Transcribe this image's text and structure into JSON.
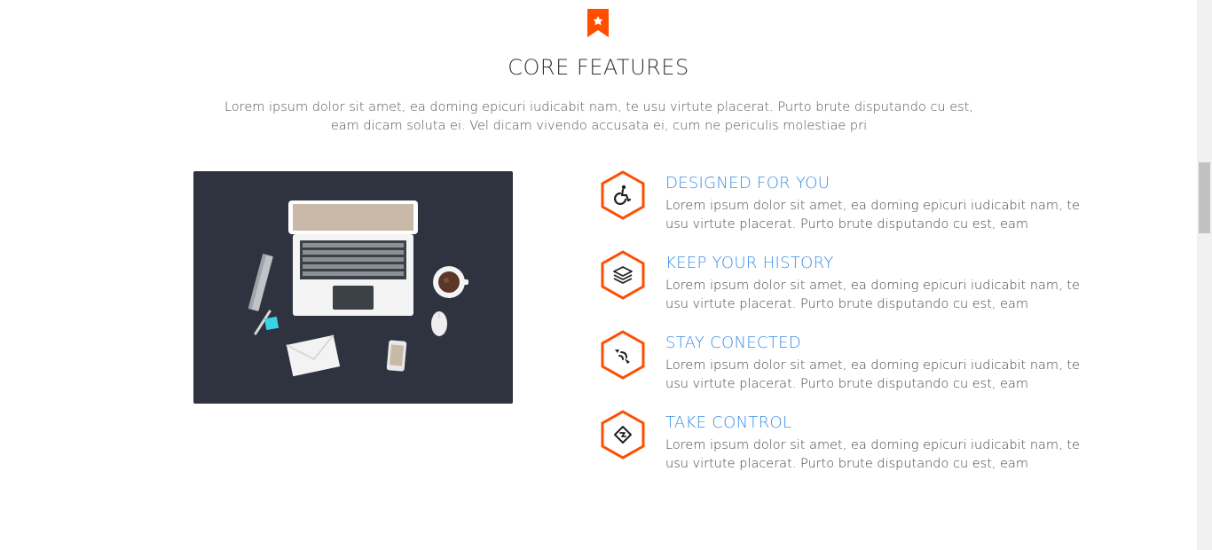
{
  "section": {
    "icon": "bookmark-star-icon",
    "title": "CORE FEATURES",
    "intro": "Lorem ipsum dolor sit amet, ea doming epicuri iudicabit nam, te usu virtute placerat. Purto brute disputando cu est, eam dicam soluta ei. Vel dicam vivendo accusata ei, cum ne periculis molestiae pri"
  },
  "features": [
    {
      "icon": "wheelchair-icon",
      "title": "DESIGNED FOR YOU",
      "text": "Lorem ipsum dolor sit amet, ea doming epicuri iudicabit nam, te usu virtute placerat. Purto brute disputando cu est, eam"
    },
    {
      "icon": "layers-icon",
      "title": "KEEP YOUR HISTORY",
      "text": "Lorem ipsum dolor sit amet, ea doming epicuri iudicabit nam, te usu virtute placerat. Purto brute disputando cu est, eam"
    },
    {
      "icon": "connection-icon",
      "title": "STAY CONECTED",
      "text": "Lorem ipsum dolor sit amet, ea doming epicuri iudicabit nam, te usu virtute placerat. Purto brute disputando cu est, eam"
    },
    {
      "icon": "control-diamond-icon",
      "title": "TAKE CONTROL",
      "text": "Lorem ipsum dolor sit amet, ea doming epicuri iudicabit nam, te usu virtute placerat. Purto brute disputando cu est, eam"
    }
  ],
  "colors": {
    "accent": "#ff4e00",
    "heading_blue": "#3b8ee8",
    "hero_bg": "#2f3340"
  }
}
